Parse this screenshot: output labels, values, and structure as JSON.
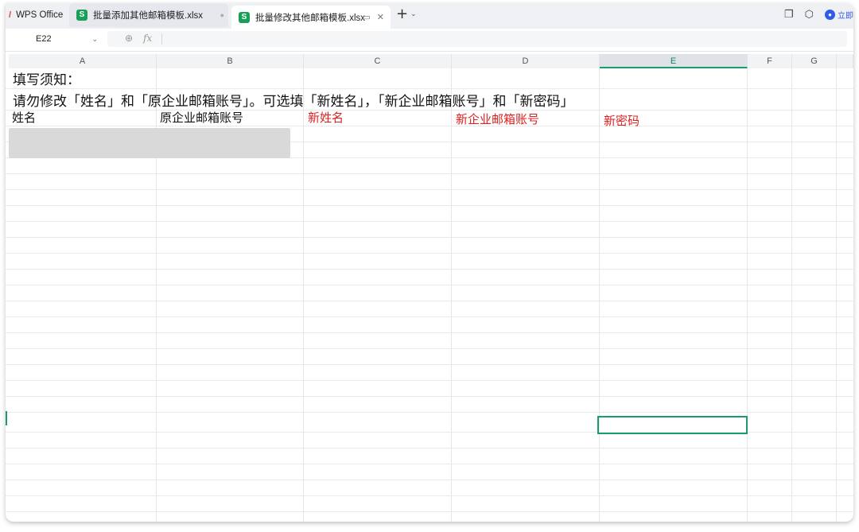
{
  "tabs": {
    "home": {
      "label": "WPS Office"
    },
    "file1": {
      "label": "批量添加其他邮箱模板.xlsx",
      "icon_letter": "S"
    },
    "file2": {
      "label": "批量修改其他邮箱模板.xlsx",
      "icon_letter": "S"
    }
  },
  "topbar": {
    "login_label": "立即"
  },
  "formula_bar": {
    "cell_ref": "E22",
    "formula": "",
    "fx_symbol": "fx"
  },
  "columns": [
    "A",
    "B",
    "C",
    "D",
    "E",
    "F",
    "G"
  ],
  "selected_column": "E",
  "sheet": {
    "notice_title": "填写须知：",
    "notice_body": "请勿修改「姓名」和「原企业邮箱账号」。可选填「新姓名」，「新企业邮箱账号」和「新密码」",
    "headers": [
      {
        "text": "姓名",
        "color": "#111111"
      },
      {
        "text": "原企业邮箱账号",
        "color": "#111111"
      },
      {
        "text": "新姓名",
        "color": "#e02020"
      },
      {
        "text": "新企业邮箱账号",
        "color": "#e02020"
      },
      {
        "text": "新密码",
        "color": "#e02020"
      }
    ]
  },
  "colors": {
    "accent": "#1a9c6c",
    "required_red": "#e02020",
    "sheet_icon": "#18a058",
    "login_blue": "#2f5bea"
  }
}
